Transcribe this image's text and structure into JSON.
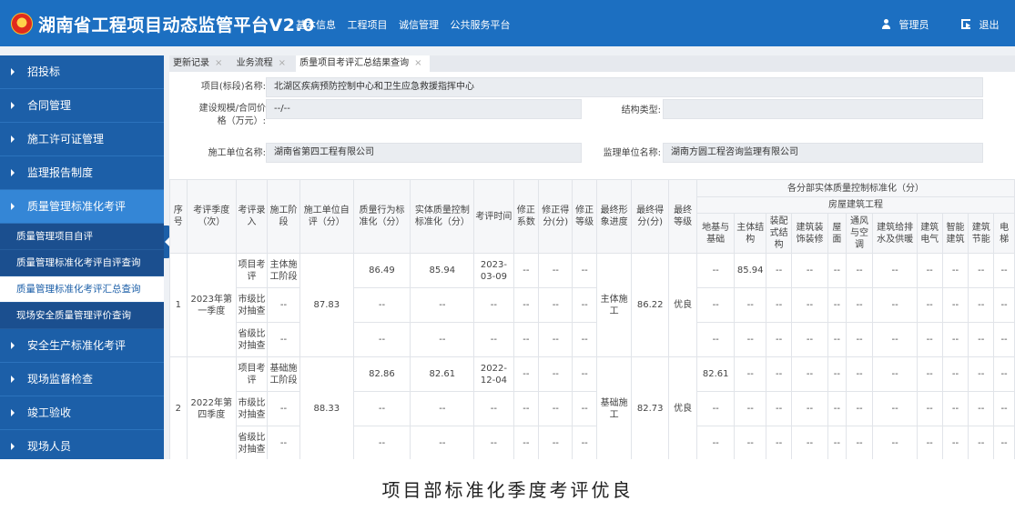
{
  "header": {
    "title": "湖南省工程项目动态监管平台V2.0",
    "nav": [
      "基本信息",
      "工程项目",
      "诚信管理",
      "公共服务平台"
    ],
    "user_label": "管理员",
    "logout_label": "退出"
  },
  "colors": {
    "header_bg": "#1c6fc1",
    "sidebar_bg": "#1c5fa8",
    "sidebar_active": "#3486d6",
    "sidebar_sub_bg": "#1b4f8f"
  },
  "icons": {
    "logo": "emblem-icon",
    "user": "user-icon",
    "logout": "logout-icon",
    "collapse": "collapse-left-icon",
    "menu": "triangle-right-icon"
  },
  "sidebar": {
    "items": [
      "招投标",
      "合同管理",
      "施工许可证管理",
      "监理报告制度",
      "质量管理标准化考评"
    ],
    "sub_items": [
      "质量管理项目自评",
      "质量管理标准化考评自评查询",
      "质量管理标准化考评汇总查询",
      "现场安全质量管理评价查询"
    ],
    "items_after": [
      "安全生产标准化考评",
      "现场监督检查",
      "竣工验收",
      "现场人员"
    ]
  },
  "tabs": [
    {
      "label": "更新记录",
      "close": "×"
    },
    {
      "label": "业务流程",
      "close": "×"
    },
    {
      "label": "质量项目考评汇总结果查询",
      "close": "×"
    }
  ],
  "form": {
    "project_name_label": "项目(标段)名称:",
    "project_name": "北湖区疾病预防控制中心和卫生应急救援指挥中心",
    "scale_label_1": "建设规模/合同价",
    "scale_label_2": "格（万元）:",
    "scale_value": "--/--",
    "structure_label": "结构类型:",
    "structure_value": "",
    "contractor_label": "施工单位名称:",
    "contractor": "湖南省第四工程有限公司",
    "supervisor_label": "监理单位名称:",
    "supervisor": "湖南方圆工程咨询监理有限公司"
  },
  "table": {
    "headers": {
      "seq": "序号",
      "season": "考评季度（次）",
      "entry": "考评录入",
      "stage": "施工阶段",
      "self_score": "施工单位自评（分）",
      "behavior": "质量行为标准化（分）",
      "entity": "实体质量控制标准化（分）",
      "time": "考评时间",
      "coef": "修正系数",
      "corr_score": "修正得分(分)",
      "corr_level": "修正等级",
      "progress": "最终形象进度",
      "final_score": "最终得分(分)",
      "final_level": "最终等级",
      "group": "各分部实体质量控制标准化（分）",
      "subgroup": "房屋建筑工程",
      "subs": [
        "地基与基础",
        "主体结构",
        "装配式结构",
        "建筑装饰装修",
        "屋面",
        "通风与空调",
        "建筑给排水及供暖",
        "建筑电气",
        "智能建筑",
        "建筑节能",
        "电梯"
      ]
    },
    "groups": [
      {
        "seq": "1",
        "season": "2023年第一季度",
        "self_score": "87.83",
        "progress": "主体施工",
        "final_score": "86.22",
        "final_level": "优良",
        "rows": [
          {
            "entry": "项目考评",
            "stage": "主体施工阶段",
            "behavior": "86.49",
            "entity": "85.94",
            "time": "2023-03-09",
            "coef": "--",
            "corr_score": "--",
            "corr_level": "--",
            "subs": [
              "--",
              "85.94",
              "--",
              "--",
              "--",
              "--",
              "--",
              "--",
              "--",
              "--",
              "--"
            ]
          },
          {
            "entry": "市级比对抽查",
            "stage": "--",
            "behavior": "--",
            "entity": "--",
            "time": "--",
            "coef": "--",
            "corr_score": "--",
            "corr_level": "--",
            "subs": [
              "--",
              "--",
              "--",
              "--",
              "--",
              "--",
              "--",
              "--",
              "--",
              "--",
              "--"
            ]
          },
          {
            "entry": "省级比对抽查",
            "stage": "--",
            "behavior": "--",
            "entity": "--",
            "time": "--",
            "coef": "--",
            "corr_score": "--",
            "corr_level": "--",
            "subs": [
              "--",
              "--",
              "--",
              "--",
              "--",
              "--",
              "--",
              "--",
              "--",
              "--",
              "--"
            ]
          }
        ]
      },
      {
        "seq": "2",
        "season": "2022年第四季度",
        "self_score": "88.33",
        "progress": "基础施工",
        "final_score": "82.73",
        "final_level": "优良",
        "rows": [
          {
            "entry": "项目考评",
            "stage": "基础施工阶段",
            "behavior": "82.86",
            "entity": "82.61",
            "time": "2022-12-04",
            "coef": "--",
            "corr_score": "--",
            "corr_level": "--",
            "subs": [
              "82.61",
              "--",
              "--",
              "--",
              "--",
              "--",
              "--",
              "--",
              "--",
              "--",
              "--"
            ]
          },
          {
            "entry": "市级比对抽查",
            "stage": "--",
            "behavior": "--",
            "entity": "--",
            "time": "--",
            "coef": "--",
            "corr_score": "--",
            "corr_level": "--",
            "subs": [
              "--",
              "--",
              "--",
              "--",
              "--",
              "--",
              "--",
              "--",
              "--",
              "--",
              "--"
            ]
          },
          {
            "entry": "省级比对抽查",
            "stage": "--",
            "behavior": "--",
            "entity": "--",
            "time": "--",
            "coef": "--",
            "corr_score": "--",
            "corr_level": "--",
            "subs": [
              "--",
              "--",
              "--",
              "--",
              "--",
              "--",
              "--",
              "--",
              "--",
              "--",
              "--"
            ]
          }
        ]
      }
    ]
  },
  "caption": "项目部标准化季度考评优良"
}
